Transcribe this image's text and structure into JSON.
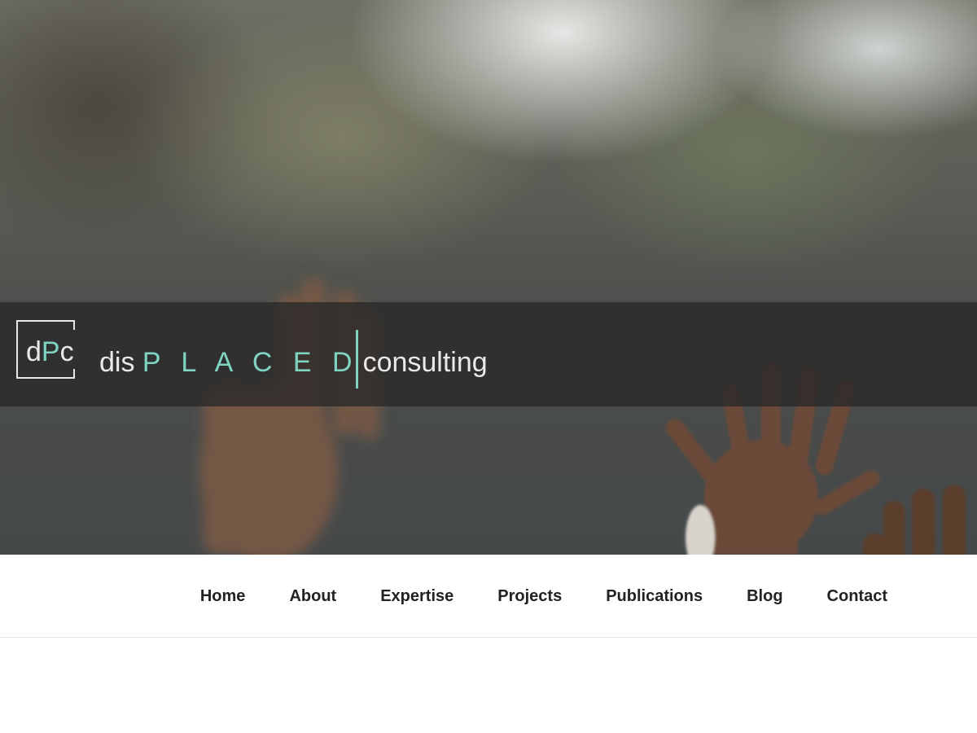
{
  "brand": {
    "logo_text_1": "d",
    "logo_text_2": "P",
    "logo_text_3": "c",
    "name_prefix": "dis",
    "name_accent": "P L A C E D",
    "name_suffix": "consulting",
    "accent_color": "#7fd3c1"
  },
  "nav": {
    "items": [
      {
        "label": "Home"
      },
      {
        "label": "About"
      },
      {
        "label": "Expertise"
      },
      {
        "label": "Projects"
      },
      {
        "label": "Publications"
      },
      {
        "label": "Blog"
      },
      {
        "label": "Contact"
      }
    ]
  }
}
